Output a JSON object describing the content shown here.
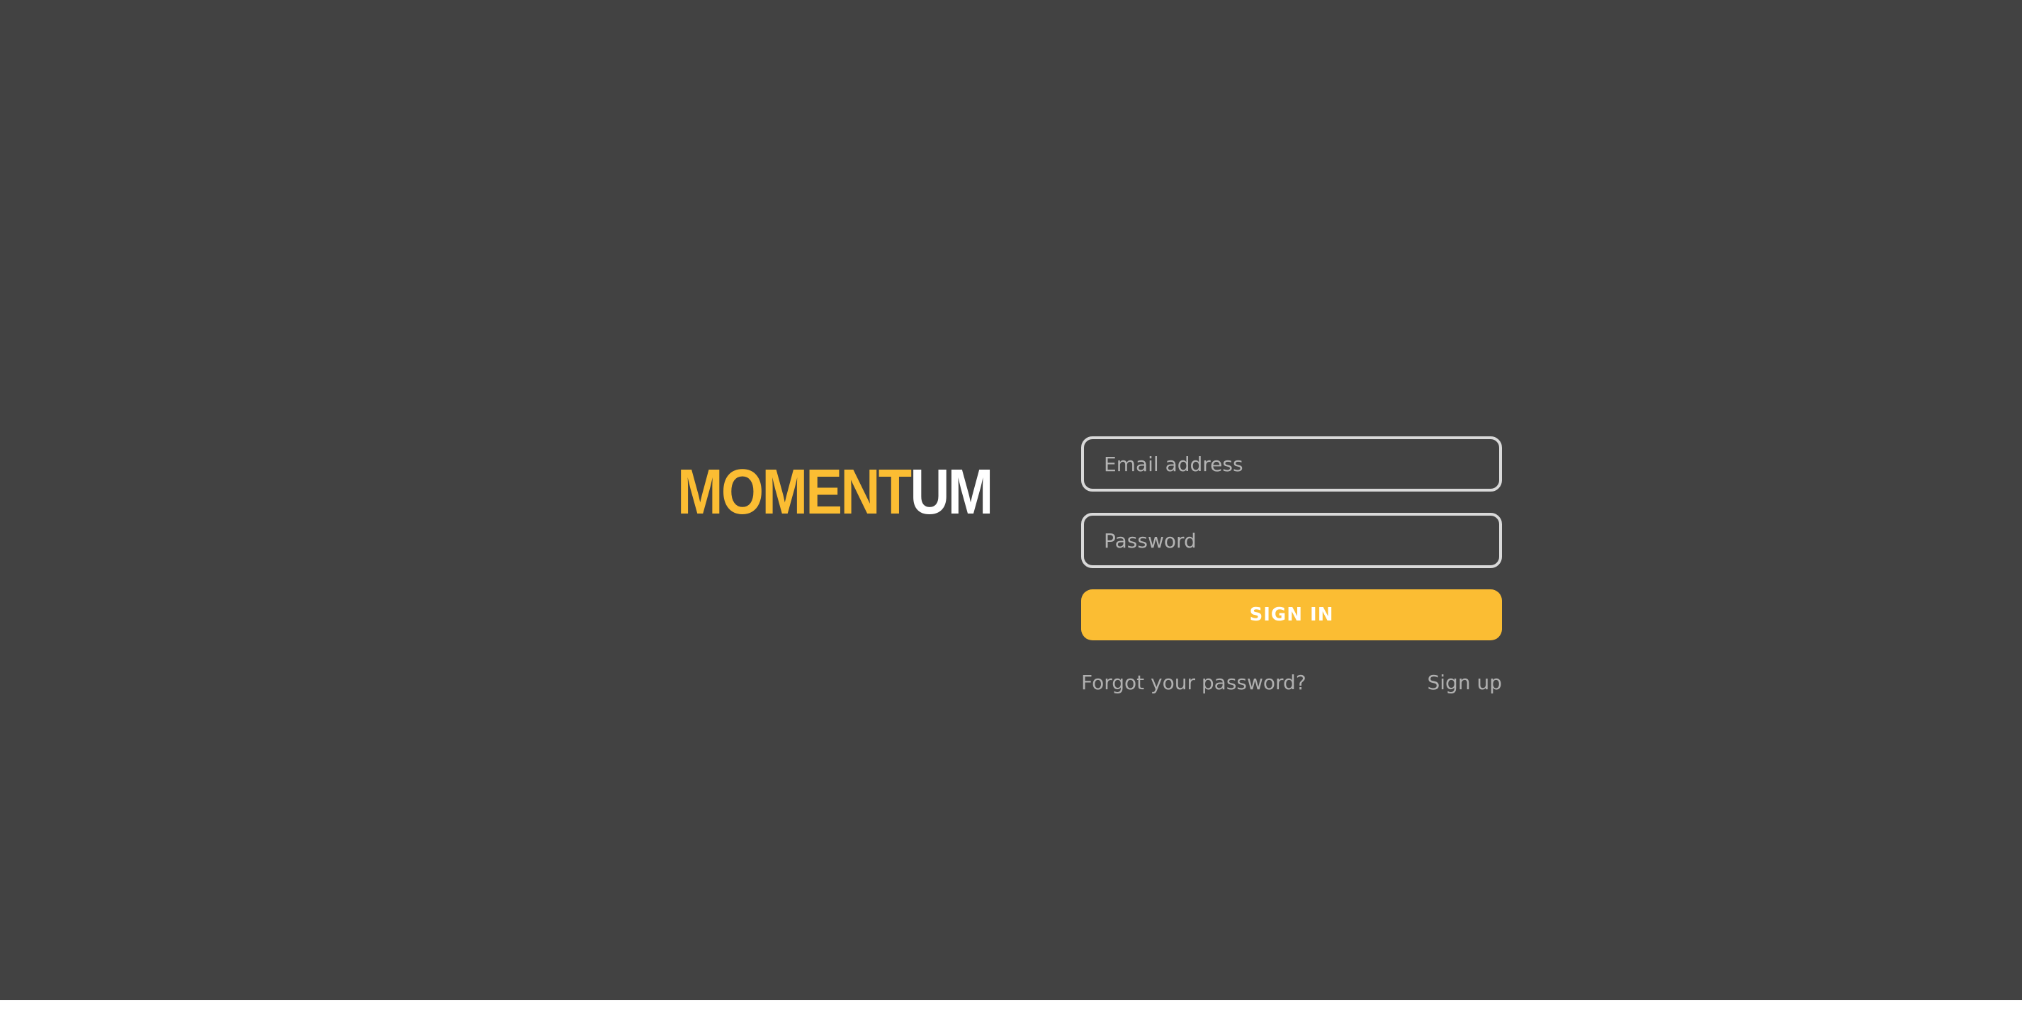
{
  "brand": {
    "logo_accent": "MOMENT",
    "logo_rest": "UM",
    "accent_color": "#fbbd33"
  },
  "form": {
    "email_placeholder": "Email address",
    "password_placeholder": "Password",
    "signin_label": "SIGN IN",
    "forgot_label": "Forgot your password?",
    "signup_label": "Sign up"
  },
  "colors": {
    "background": "#424242",
    "field_border": "#d9d9d9",
    "link_text": "#b0b0b0"
  }
}
